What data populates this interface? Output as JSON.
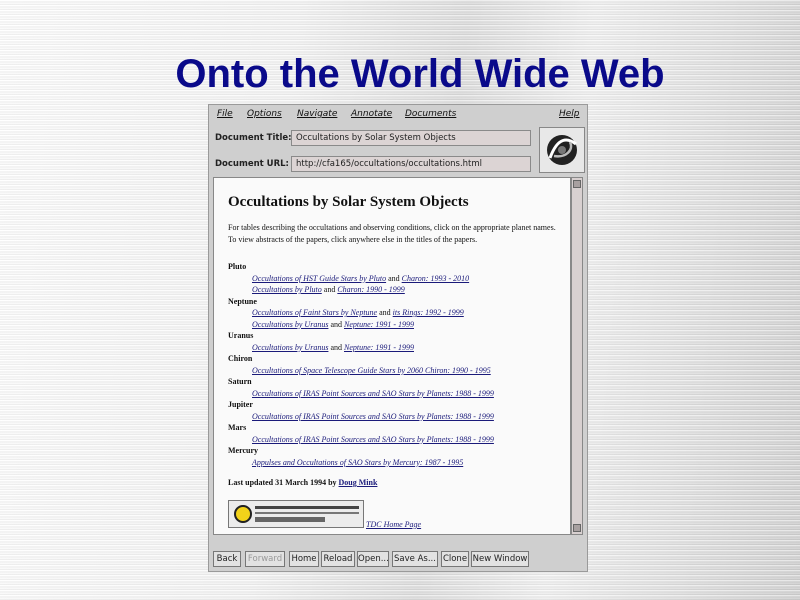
{
  "slide": {
    "title": "Onto the World Wide Web"
  },
  "menu": {
    "file": "File",
    "options": "Options",
    "navigate": "Navigate",
    "annotate": "Annotate",
    "documents": "Documents",
    "help": "Help"
  },
  "fields": {
    "title_label": "Document Title:",
    "title_value": "Occultations by Solar System Objects",
    "url_label": "Document URL:",
    "url_value": "http://cfa165/occultations/occultations.html"
  },
  "doc": {
    "heading": "Occultations by Solar System Objects",
    "intro": "For tables describing the occultations and observing conditions, click on the appropriate planet names. To view abstracts of the papers, click anywhere else in the titles of the papers.",
    "sections": [
      {
        "planet": "Pluto",
        "links": [
          [
            "Occultations of HST Guide Stars by Pluto",
            " and ",
            "Charon: 1993 - 2010"
          ],
          [
            "Occultations by Pluto",
            " and ",
            "Charon: 1990 - 1999"
          ]
        ]
      },
      {
        "planet": "Neptune",
        "links": [
          [
            "Occultations of Faint Stars by Neptune",
            " and ",
            "its Rings: 1992 - 1999"
          ],
          [
            "Occultations by Uranus",
            " and ",
            "Neptune: 1991 - 1999"
          ]
        ]
      },
      {
        "planet": "Uranus",
        "links": [
          [
            "Occultations by Uranus",
            " and ",
            "Neptune: 1991 - 1999"
          ]
        ]
      },
      {
        "planet": "Chiron",
        "links": [
          [
            "Occultations of Space Telescope Guide Stars by 2060 Chiron: 1990 - 1995",
            "",
            ""
          ]
        ]
      },
      {
        "planet": "Saturn",
        "links": [
          [
            "Occultations of IRAS Point Sources and SAO Stars by Planets: 1988 - 1999",
            "",
            ""
          ]
        ]
      },
      {
        "planet": "Jupiter",
        "links": [
          [
            "Occultations of IRAS Point Sources and SAO Stars by Planets: 1988 - 1999",
            "",
            ""
          ]
        ]
      },
      {
        "planet": "Mars",
        "links": [
          [
            "Occultations of IRAS Point Sources and SAO Stars by Planets: 1988 - 1999",
            "",
            ""
          ]
        ]
      },
      {
        "planet": "Mercury",
        "links": [
          [
            "Appulses and Occultations of SAO Stars by Mercury: 1987 - 1995",
            "",
            ""
          ]
        ]
      }
    ],
    "updated_prefix": "Last updated 31 March 1994 by ",
    "updated_author": "Doug Mink",
    "tdc_link": "TDC Home Page"
  },
  "buttons": {
    "back": "Back",
    "forward": "Forward",
    "home": "Home",
    "reload": "Reload",
    "open": "Open...",
    "save_as": "Save As...",
    "clone": "Clone",
    "new_window": "New Window"
  },
  "colors": {
    "title": "#0a0a8a",
    "link": "#1a1a7a",
    "panel": "#cfcfcf"
  }
}
